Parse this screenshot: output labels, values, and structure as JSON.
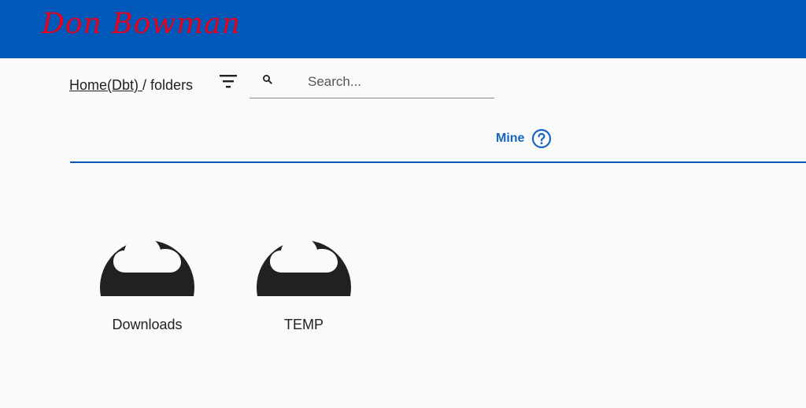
{
  "header": {
    "brand": "Don Bowman",
    "background_color": "#0058b8",
    "brand_color": "#e8001c"
  },
  "breadcrumb": {
    "home_label": "Home(Dbt) ",
    "separator": "/",
    "current": " folders"
  },
  "toolbar": {
    "filter_icon": "filter-icon"
  },
  "search": {
    "placeholder": "Search...",
    "value": "",
    "icon": "search-icon"
  },
  "tabs": [
    {
      "label": "Mine",
      "icon": "help-circle-icon",
      "active": true
    }
  ],
  "folders": [
    {
      "name": "Downloads",
      "icon": "cloud-folder-icon"
    },
    {
      "name": "TEMP",
      "icon": "cloud-folder-icon"
    }
  ],
  "colors": {
    "accent": "#1565c0",
    "folder_icon": "#212121"
  }
}
